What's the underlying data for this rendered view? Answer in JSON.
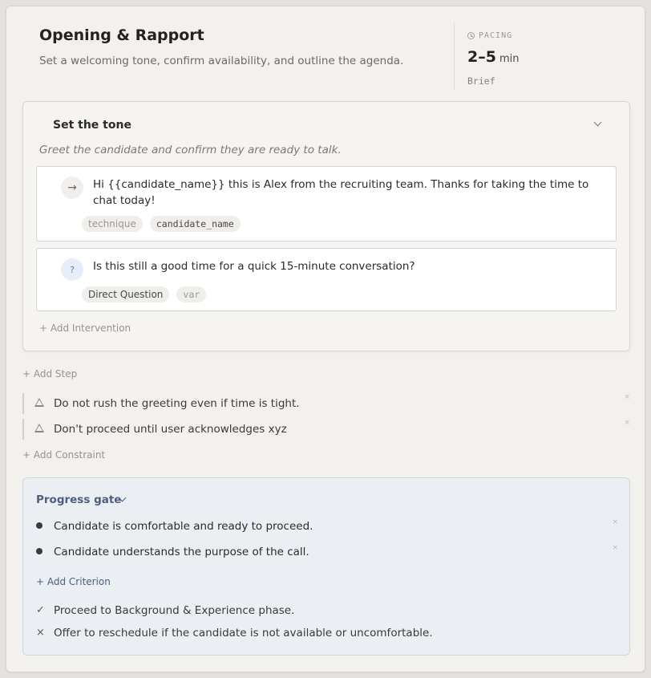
{
  "phase": {
    "title": "Opening & Rapport",
    "subtitle": "Set a welcoming tone, confirm availability, and outline the agenda."
  },
  "pacing": {
    "label": "PACING",
    "value": "2–5",
    "unit": "min",
    "note": "Brief"
  },
  "step": {
    "title": "Set the tone",
    "description": "Greet the candidate and confirm they are ready to talk.",
    "interventions": [
      {
        "icon": "→",
        "text": "Hi {{candidate_name}} this is Alex from the recruiting team. Thanks for taking the time to chat today!",
        "tags": [
          "technique",
          "candidate_name"
        ]
      },
      {
        "icon": "?",
        "text": "Is this still a good time for a quick 15-minute conversation?",
        "tags": [
          "Direct Question",
          "var"
        ]
      }
    ],
    "add_intervention": "+ Add Intervention"
  },
  "add_step": "+ Add Step",
  "constraints": [
    "Do not rush the greeting even if time is tight.",
    "Don't proceed until user acknowledges xyz"
  ],
  "remove_glyph": "×",
  "add_constraint": "+ Add Constraint",
  "gate": {
    "title": "Progress gate",
    "criteria": [
      "Candidate is comfortable and ready to proceed.",
      "Candidate understands the purpose of the call."
    ],
    "add_criterion": "+ Add Criterion",
    "outcomes": [
      {
        "icon": "✓",
        "text": "Proceed to Background & Experience phase."
      },
      {
        "icon": "×",
        "text": "Offer to reschedule if the candidate is not available or uncomfortable."
      }
    ]
  }
}
